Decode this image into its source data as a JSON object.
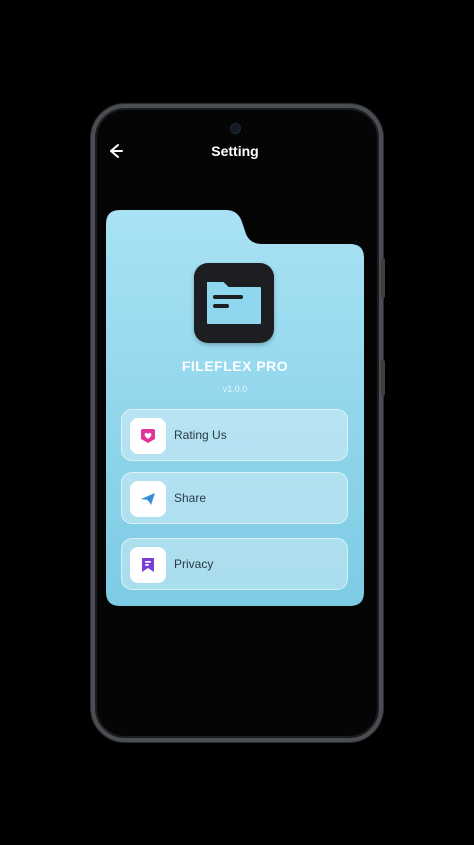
{
  "header": {
    "title": "Setting"
  },
  "app": {
    "name": "FILEFLEX PRO",
    "version": "v1.0.0"
  },
  "menu": [
    {
      "label": "Rating Us",
      "icon": "heart-badge-icon",
      "color": "#e0369a"
    },
    {
      "label": "Share",
      "icon": "paper-plane-icon",
      "color": "#3a8fe0"
    },
    {
      "label": "Privacy",
      "icon": "bookmark-shield-icon",
      "color": "#7b3bd6"
    }
  ],
  "colors": {
    "card_top": "#a9e2f4",
    "card_bottom": "#7ccbe4",
    "icon_screen": "#8fd7ee"
  }
}
